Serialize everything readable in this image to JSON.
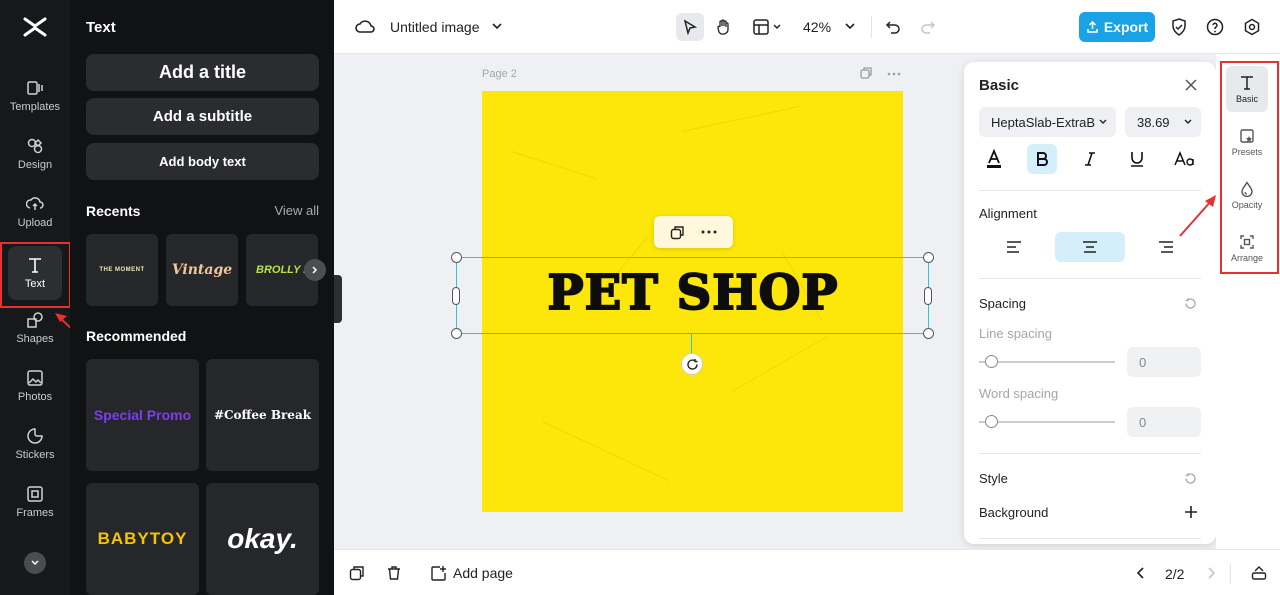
{
  "rail": {
    "items": [
      {
        "label": "Templates",
        "icon": "templates-icon"
      },
      {
        "label": "Design",
        "icon": "design-icon"
      },
      {
        "label": "Upload",
        "icon": "upload-icon"
      },
      {
        "label": "Text",
        "icon": "text-icon"
      },
      {
        "label": "Shapes",
        "icon": "shapes-icon"
      },
      {
        "label": "Photos",
        "icon": "photos-icon"
      },
      {
        "label": "Stickers",
        "icon": "stickers-icon"
      },
      {
        "label": "Frames",
        "icon": "frames-icon"
      }
    ]
  },
  "panel": {
    "title": "Text",
    "add_title": "Add a title",
    "add_subtitle": "Add a subtitle",
    "add_body": "Add body text",
    "recents_label": "Recents",
    "view_all": "View all",
    "recents": [
      "THE MOMENT",
      "Vintage",
      "BROLLY HO"
    ],
    "recommended_label": "Recommended",
    "recommended": [
      "Special Promo",
      "#Coffee Break",
      "BABYTOY",
      "okay."
    ]
  },
  "topbar": {
    "doc_title": "Untitled image",
    "zoom": "42%",
    "export_label": "Export"
  },
  "canvas": {
    "page_label": "Page 2",
    "headline": "PET SHOP",
    "background_color": "#fde609"
  },
  "basic": {
    "title": "Basic",
    "font_family": "HeptaSlab-ExtraB",
    "font_size": "38.69",
    "alignment_label": "Alignment",
    "spacing_label": "Spacing",
    "line_spacing_label": "Line spacing",
    "line_spacing_value": "0",
    "word_spacing_label": "Word spacing",
    "word_spacing_value": "0",
    "style_label": "Style",
    "background_label": "Background"
  },
  "rtools": {
    "basic": "Basic",
    "presets": "Presets",
    "opacity": "Opacity",
    "arrange": "Arrange"
  },
  "bottombar": {
    "add_page": "Add page",
    "page_counter": "2/2"
  },
  "colors": {
    "accent": "#1aa2e6",
    "selection": "#2ec4d6",
    "highlight": "#e8312f"
  }
}
